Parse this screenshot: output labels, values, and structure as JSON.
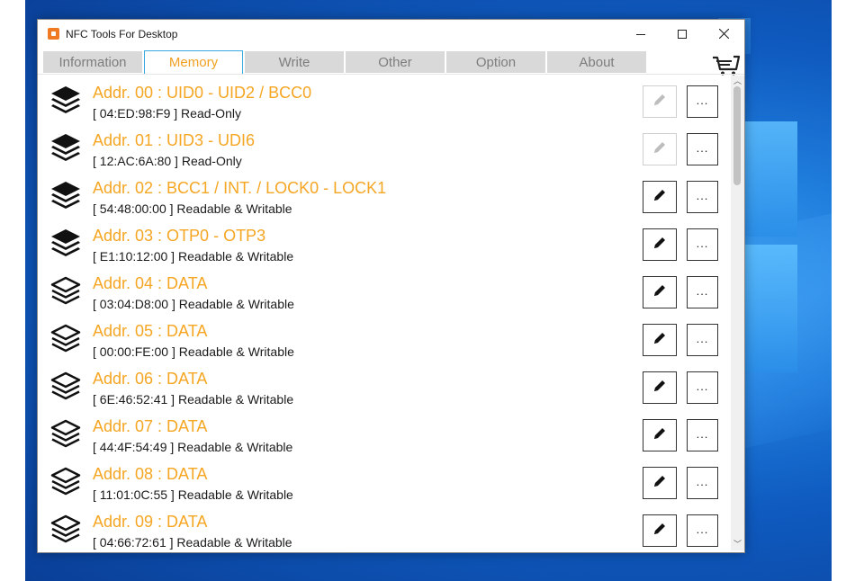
{
  "window": {
    "title": "NFC Tools For Desktop"
  },
  "tabs": [
    {
      "label": "Information",
      "active": false
    },
    {
      "label": "Memory",
      "active": true
    },
    {
      "label": "Write",
      "active": false
    },
    {
      "label": "Other",
      "active": false
    },
    {
      "label": "Option",
      "active": false
    },
    {
      "label": "About",
      "active": false
    }
  ],
  "memory": {
    "more_label": "...",
    "rows": [
      {
        "title": "Addr. 00 : UID0 - UID2 / BCC0",
        "detail": "[ 04:ED:98:F9 ] Read-Only",
        "icon": "layers-filled-icon",
        "editable": false
      },
      {
        "title": "Addr. 01 : UID3 - UDI6",
        "detail": "[ 12:AC:6A:80 ] Read-Only",
        "icon": "layers-filled-icon",
        "editable": false
      },
      {
        "title": "Addr. 02 : BCC1 / INT. / LOCK0 - LOCK1",
        "detail": "[ 54:48:00:00 ] Readable & Writable",
        "icon": "layers-filled-icon",
        "editable": true
      },
      {
        "title": "Addr. 03 : OTP0 - OTP3",
        "detail": "[ E1:10:12:00 ] Readable & Writable",
        "icon": "layers-filled-icon",
        "editable": true
      },
      {
        "title": "Addr. 04 : DATA",
        "detail": "[ 03:04:D8:00 ] Readable & Writable",
        "icon": "layers-outline-icon",
        "editable": true
      },
      {
        "title": "Addr. 05 : DATA",
        "detail": "[ 00:00:FE:00 ] Readable & Writable",
        "icon": "layers-outline-icon",
        "editable": true
      },
      {
        "title": "Addr. 06 : DATA",
        "detail": "[ 6E:46:52:41 ] Readable & Writable",
        "icon": "layers-outline-icon",
        "editable": true
      },
      {
        "title": "Addr. 07 : DATA",
        "detail": "[ 44:4F:54:49 ] Readable & Writable",
        "icon": "layers-outline-icon",
        "editable": true
      },
      {
        "title": "Addr. 08 : DATA",
        "detail": "[ 11:01:0C:55 ] Readable & Writable",
        "icon": "layers-outline-icon",
        "editable": true
      },
      {
        "title": "Addr. 09 : DATA",
        "detail": "[ 04:66:72:61 ] Readable & Writable",
        "icon": "layers-outline-icon",
        "editable": true
      }
    ]
  },
  "colors": {
    "accent": "#f5a623",
    "active_tab_border": "#38a8e0",
    "app_icon": "#f07a22"
  }
}
